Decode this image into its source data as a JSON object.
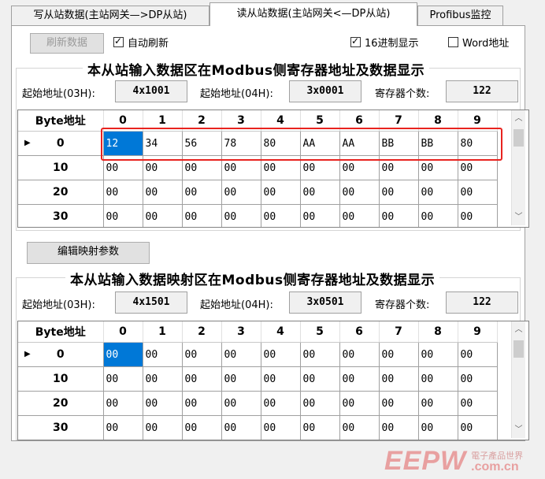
{
  "tabs": [
    "写从站数据(主站网关—>DP从站)",
    "读从站数据(主站网关<—DP从站)",
    "Profibus监控"
  ],
  "toolbar": {
    "refresh_button": "刷新数据",
    "auto_refresh": {
      "label": "自动刷新",
      "checked": true
    },
    "hex_display": {
      "label": "16进制显示",
      "checked": true
    },
    "word_address": {
      "label": "Word地址",
      "checked": false
    }
  },
  "input_area": {
    "title": "本从站输入数据区在Modbus侧寄存器地址及数据显示",
    "start_03h_label": "起始地址(03H):",
    "start_03h_value": "4x1001",
    "start_04h_label": "起始地址(04H):",
    "start_04h_value": "3x0001",
    "reg_count_label": "寄存器个数:",
    "reg_count_value": "122",
    "grid": {
      "header": [
        "Byte地址",
        "0",
        "1",
        "2",
        "3",
        "4",
        "5",
        "6",
        "7",
        "8",
        "9"
      ],
      "rows": [
        {
          "addr": "0",
          "cells": [
            "12",
            "34",
            "56",
            "78",
            "80",
            "AA",
            "AA",
            "BB",
            "BB",
            "80"
          ]
        },
        {
          "addr": "10",
          "cells": [
            "00",
            "00",
            "00",
            "00",
            "00",
            "00",
            "00",
            "00",
            "00",
            "00"
          ]
        },
        {
          "addr": "20",
          "cells": [
            "00",
            "00",
            "00",
            "00",
            "00",
            "00",
            "00",
            "00",
            "00",
            "00"
          ]
        },
        {
          "addr": "30",
          "cells": [
            "00",
            "00",
            "00",
            "00",
            "00",
            "00",
            "00",
            "00",
            "00",
            "00"
          ]
        }
      ]
    }
  },
  "edit_mapping_button": "编辑映射参数",
  "mapping_area": {
    "title": "本从站输入数据映射区在Modbus侧寄存器地址及数据显示",
    "start_03h_label": "起始地址(03H):",
    "start_03h_value": "4x1501",
    "start_04h_label": "起始地址(04H):",
    "start_04h_value": "3x0501",
    "reg_count_label": "寄存器个数:",
    "reg_count_value": "122",
    "grid": {
      "header": [
        "Byte地址",
        "0",
        "1",
        "2",
        "3",
        "4",
        "5",
        "6",
        "7",
        "8",
        "9"
      ],
      "rows": [
        {
          "addr": "0",
          "cells": [
            "00",
            "00",
            "00",
            "00",
            "00",
            "00",
            "00",
            "00",
            "00",
            "00"
          ]
        },
        {
          "addr": "10",
          "cells": [
            "00",
            "00",
            "00",
            "00",
            "00",
            "00",
            "00",
            "00",
            "00",
            "00"
          ]
        },
        {
          "addr": "20",
          "cells": [
            "00",
            "00",
            "00",
            "00",
            "00",
            "00",
            "00",
            "00",
            "00",
            "00"
          ]
        },
        {
          "addr": "30",
          "cells": [
            "00",
            "00",
            "00",
            "00",
            "00",
            "00",
            "00",
            "00",
            "00",
            "00"
          ]
        }
      ]
    }
  },
  "watermark": {
    "logo": "EEPW",
    "tagline": "電子產品世界",
    "domain": ".com.cn"
  },
  "colors": {
    "selection": "#0078d7",
    "highlight_box": "#e8231f"
  },
  "icons": {
    "row_pointer": "triangle-right-icon",
    "scroll_up": "chevron-up-icon",
    "scroll_down": "chevron-down-icon",
    "checkbox": "check-icon"
  }
}
